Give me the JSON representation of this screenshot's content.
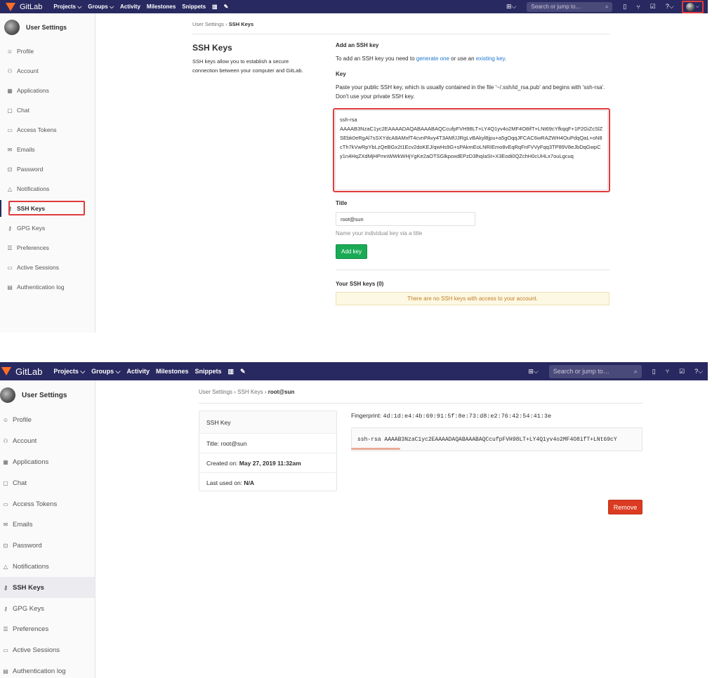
{
  "navbar": {
    "logo": "GitLab",
    "links": [
      "Projects ⌵",
      "Groups ⌵",
      "Activity",
      "Milestones",
      "Snippets"
    ],
    "search_placeholder": "Search or jump to…"
  },
  "sidebar": {
    "title": "User Settings",
    "items": [
      {
        "label": "Profile",
        "icon": "profile-icon",
        "glyph": "☺"
      },
      {
        "label": "Account",
        "icon": "account-icon",
        "glyph": "⚇"
      },
      {
        "label": "Applications",
        "icon": "applications-icon",
        "glyph": "▦"
      },
      {
        "label": "Chat",
        "icon": "chat-icon",
        "glyph": "▢"
      },
      {
        "label": "Access Tokens",
        "icon": "access-tokens-icon",
        "glyph": "▭"
      },
      {
        "label": "Emails",
        "icon": "emails-icon",
        "glyph": "✉"
      },
      {
        "label": "Password",
        "icon": "password-icon",
        "glyph": "🔒"
      },
      {
        "label": "Notifications",
        "icon": "notifications-icon",
        "glyph": "△"
      },
      {
        "label": "SSH Keys",
        "icon": "key-icon",
        "glyph": "⚷"
      },
      {
        "label": "GPG Keys",
        "icon": "gpg-key-icon",
        "glyph": "⚷"
      },
      {
        "label": "Preferences",
        "icon": "preferences-icon",
        "glyph": "☰"
      },
      {
        "label": "Active Sessions",
        "icon": "sessions-icon",
        "glyph": "▭"
      },
      {
        "label": "Authentication log",
        "icon": "log-icon",
        "glyph": "▤"
      }
    ]
  },
  "page1": {
    "breadcrumb_parent": "User Settings",
    "breadcrumb_sep": "›",
    "breadcrumb_current": "SSH Keys",
    "title": "SSH Keys",
    "description": "SSH keys allow you to establish a secure connection between your computer and GitLab.",
    "add_heading": "Add an SSH key",
    "add_text_pre": "To add an SSH key you need to",
    "add_link1": "generate one",
    "add_text_mid": "or use an",
    "add_link2": "existing key",
    "add_text_end": ".",
    "key_label": "Key",
    "key_help": "Paste your public SSH key, which is usually contained in the file '~/.ssh/id_rsa.pub' and begins with 'ssh-rsa'. Don't use your private SSH key.",
    "key_value": "ssh-rsa\nAAAAB3NzaC1yc2EAAAADAQABAAABAQCcufpFVH98LT+LY4Q1yv4o2MF4O8ifT+LNt69cYfkqqF+1P2GiZcSlZSEbk0eRgAl7sSXYdcA8AMxfT4cvnPAvy4T3AMfJJRgLvBAkyl8jpu+a5gOqqJFCAC6wRAZWH4OuPdqQaL+oN8cTh7kVwRpYbLzQeBGx2t1Ecv2doKEJ/qwHs9G+sPAkmEoLNRIEmo8vEqRqFnFVVyFqq3TP89V8eJbDqGwpCy1n4HqZXdMjHPmnWWkWHjYgKe2aOTSGlkpoxdEPzD3lhqIaSt+X3Eodi0QZchH0cUHLx7ouLgcuq",
    "title_label": "Title",
    "title_value": "root@sun",
    "title_help": "Name your individual key via a title",
    "add_button": "Add key",
    "your_keys": "Your SSH keys (0)",
    "no_keys": "There are no SSH keys with access to your account."
  },
  "page2": {
    "breadcrumb_parent": "User Settings",
    "breadcrumb_mid": "SSH Keys",
    "breadcrumb_sep": "›",
    "breadcrumb_current": "root@sun",
    "card_title": "SSH Key",
    "title_label": "Title:",
    "title_value": "root@sun",
    "created_label": "Created on:",
    "created_value": "May 27, 2019 11:32am",
    "last_used_label": "Last used on:",
    "last_used_value": "N/A",
    "fingerprint_label": "Fingerprint:",
    "fingerprint": "4d:1d:e4:4b:69:91:5f:8e:73:d8:e2:76:42:54:41:3e",
    "key_preview": "ssh-rsa AAAAB3NzaC1yc2EAAAADAQABAAABAQCcufpFVH98LT+LY4Q1yv4o2MF4O8ifT+LNt69cY",
    "remove_button": "Remove"
  },
  "colors": {
    "navbar": "#292961",
    "green": "#1aaa55",
    "red": "#db3b21",
    "highlight": "#e03a3a"
  }
}
